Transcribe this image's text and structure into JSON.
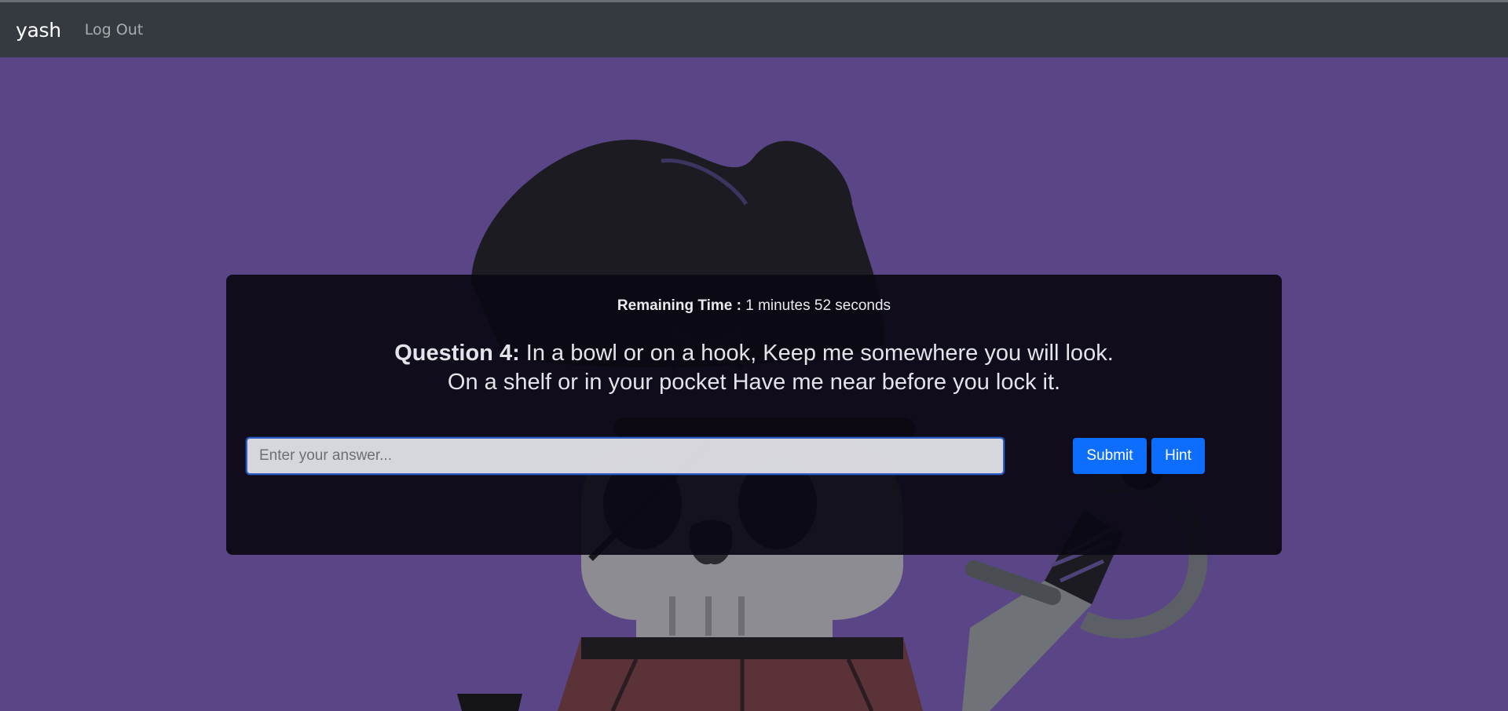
{
  "navbar": {
    "brand": "yash",
    "logout_label": "Log Out"
  },
  "quiz": {
    "timer_label": "Remaining Time :",
    "timer_value": "1 minutes 52 seconds",
    "question_label": "Question 4:",
    "question_line1": "In a bowl or on a hook, Keep me somewhere you will look.",
    "question_line2": "On a shelf or in your pocket Have me near before you lock it.",
    "answer_placeholder": "Enter your answer...",
    "submit_label": "Submit",
    "hint_label": "Hint"
  },
  "background": {
    "illustration": "pirate-skull-illustration",
    "color": "#5a4686"
  },
  "colors": {
    "navbar": "#343a40",
    "primary_button": "#0d6efd",
    "card": "#0a0812"
  }
}
